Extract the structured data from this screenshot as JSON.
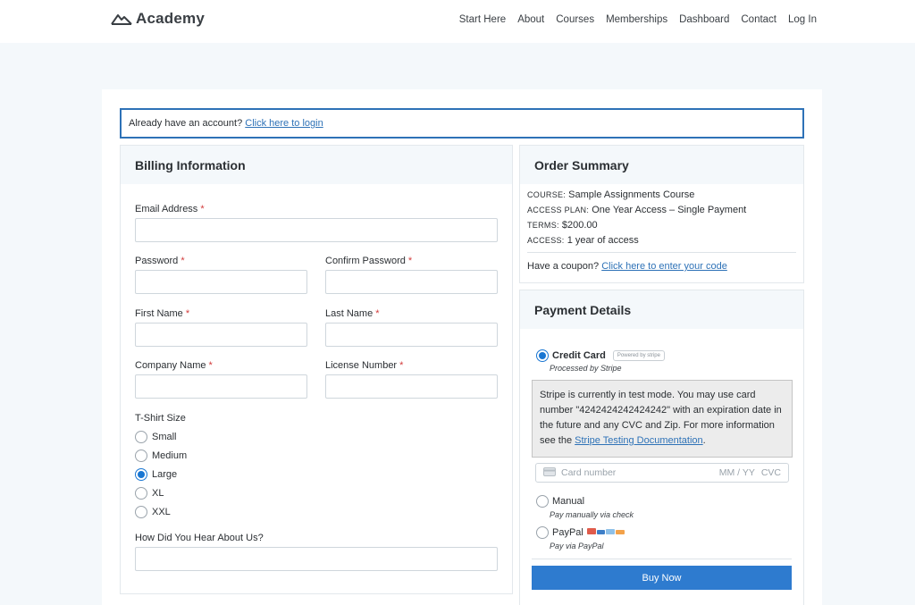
{
  "header": {
    "logo_text": "Academy",
    "nav": [
      "Start Here",
      "About",
      "Courses",
      "Memberships",
      "Dashboard",
      "Contact",
      "Log In"
    ]
  },
  "login_notice": {
    "text": "Already have an account?",
    "link": "Click here to login"
  },
  "billing": {
    "title": "Billing Information",
    "required_mark": "*",
    "email_label": "Email Address",
    "password_label": "Password",
    "confirm_password_label": "Confirm Password",
    "first_name_label": "First Name",
    "last_name_label": "Last Name",
    "company_label": "Company Name",
    "license_label": "License Number",
    "tshirt_label": "T-Shirt Size",
    "tshirt_options": [
      "Small",
      "Medium",
      "Large",
      "XL",
      "XXL"
    ],
    "tshirt_selected": "Large",
    "hear_label": "How Did You Hear About Us?"
  },
  "summary": {
    "title": "Order Summary",
    "course_key": "COURSE:",
    "course_value": "Sample Assignments Course",
    "plan_key": "ACCESS PLAN:",
    "plan_value": "One Year Access – Single Payment",
    "terms_key": "TERMS:",
    "terms_value": "$200.00",
    "access_key": "ACCESS:",
    "access_value": "1 year of access",
    "coupon_text": "Have a coupon?",
    "coupon_link": "Click here to enter your code"
  },
  "payment": {
    "title": "Payment Details",
    "credit_label": "Credit Card",
    "credit_badge": "Powered by stripe",
    "credit_sub": "Processed by Stripe",
    "notice_text": "Stripe is currently in test mode. You may use card number \"4242424242424242\" with an expiration date in the future and any CVC and Zip. For more information see the",
    "notice_link": "Stripe Testing Documentation",
    "notice_end": ".",
    "card_number_placeholder": "Card number",
    "card_expiry_placeholder": "MM / YY",
    "card_cvc_placeholder": "CVC",
    "manual_label": "Manual",
    "manual_sub": "Pay manually via check",
    "paypal_label": "PayPal",
    "paypal_sub": "Pay via PayPal",
    "selected": "Credit Card",
    "buy_label": "Buy Now"
  },
  "colors": {
    "accent": "#2e72b7",
    "button": "#2e7bcf",
    "required": "#d23b3b",
    "page_bg": "#f4f8fb"
  },
  "icons": [
    "mountain-logo-icon",
    "card-icon",
    "paypal-cards-icon"
  ]
}
